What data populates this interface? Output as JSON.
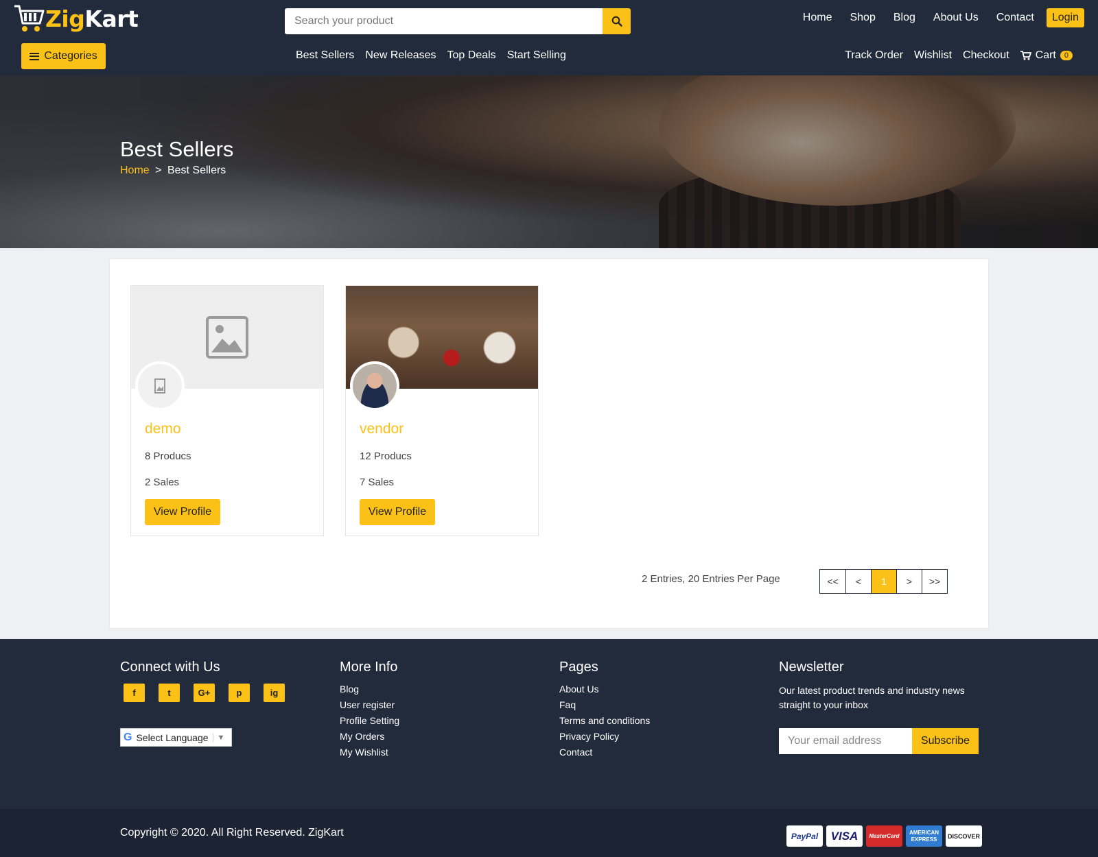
{
  "brand": {
    "logo_zig": "Zig",
    "logo_kart": "Kart"
  },
  "search": {
    "placeholder": "Search your product"
  },
  "topnav": [
    "Home",
    "Shop",
    "Blog",
    "About Us",
    "Contact"
  ],
  "login_label": "Login",
  "categories_label": "Categories",
  "subnav": [
    "Best Sellers",
    "New Releases",
    "Top Deals",
    "Start Selling"
  ],
  "rightnav": {
    "track": "Track Order",
    "wishlist": "Wishlist",
    "checkout": "Checkout",
    "cart": "Cart",
    "cart_count": "0"
  },
  "hero": {
    "title": "Best Sellers",
    "crumb_home": "Home",
    "crumb_sep": ">",
    "crumb_current": "Best Sellers"
  },
  "sellers": [
    {
      "name": "demo",
      "products": "8 Producs",
      "sales": "2 Sales",
      "button": "View Profile"
    },
    {
      "name": "vendor",
      "products": "12 Producs",
      "sales": "7 Sales",
      "button": "View Profile"
    }
  ],
  "pagination": {
    "summary": "2 Entries, 20 Entries Per Page",
    "first": "<<",
    "prev": "<",
    "current": "1",
    "next": ">",
    "last": ">>"
  },
  "footer": {
    "connect_title": "Connect with Us",
    "socials": [
      "f",
      "t",
      "G+",
      "p",
      "ig"
    ],
    "language": "Select Language",
    "more_title": "More Info",
    "more_links": [
      "Blog",
      "User register",
      "Profile Setting",
      "My Orders",
      "My Wishlist"
    ],
    "pages_title": "Pages",
    "pages_links": [
      "About Us",
      "Faq",
      "Terms and conditions",
      "Privacy Policy",
      "Contact"
    ],
    "news_title": "Newsletter",
    "news_text": "Our latest product trends and industry news straight to your inbox",
    "email_placeholder": "Your email address",
    "subscribe": "Subscribe"
  },
  "copyright": "Copyright © 2020. All Right Reserved. ZigKart",
  "payments": [
    "PayPal",
    "VISA",
    "MasterCard",
    "AMERICAN EXPRESS",
    "DISCOVER"
  ],
  "colors": {
    "accent": "#fbc117",
    "header_bg": "#222b3c",
    "footer_bottom": "#1c2433"
  }
}
